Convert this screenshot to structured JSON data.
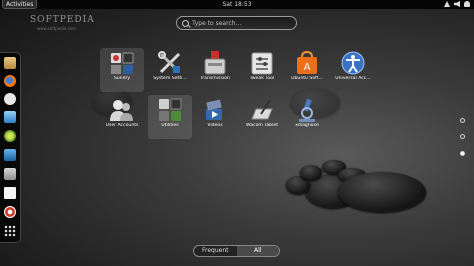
{
  "topbar": {
    "activities": "Activities",
    "clock": "Sat 18:53"
  },
  "watermark": {
    "brand": "SOFTPEDIA",
    "sub": "www.softpedia.com"
  },
  "search": {
    "placeholder": "Type to search..."
  },
  "apps": [
    {
      "label": "Sundry",
      "icon": "sundry-icon",
      "selected": true
    },
    {
      "label": "System Setti...",
      "icon": "system-settings-icon"
    },
    {
      "label": "Transmission",
      "icon": "transmission-icon"
    },
    {
      "label": "Tweak Tool",
      "icon": "tweak-tool-icon"
    },
    {
      "label": "Ubuntu Soft...",
      "icon": "ubuntu-software-icon"
    },
    {
      "label": "Universal Acc...",
      "icon": "universal-access-icon"
    },
    {
      "label": "User Accounts",
      "icon": "user-accounts-icon"
    },
    {
      "label": "Utilities",
      "icon": "utilities-icon",
      "selected": true
    },
    {
      "label": "Videos",
      "icon": "videos-icon"
    },
    {
      "label": "Wacom Tablet",
      "icon": "wacom-tablet-icon"
    },
    {
      "label": "xdiagnose",
      "icon": "xdiagnose-icon"
    }
  ],
  "dash": [
    "files-icon",
    "firefox-icon",
    "empathy-icon",
    "mail-icon",
    "software-icon",
    "screen-icon",
    "settings-icon",
    "document-icon",
    "help-icon",
    "show-apps-icon"
  ],
  "pages": {
    "count": 3,
    "current": 3
  },
  "switcher": {
    "frequent": "Frequent",
    "all": "All",
    "active": "All"
  }
}
